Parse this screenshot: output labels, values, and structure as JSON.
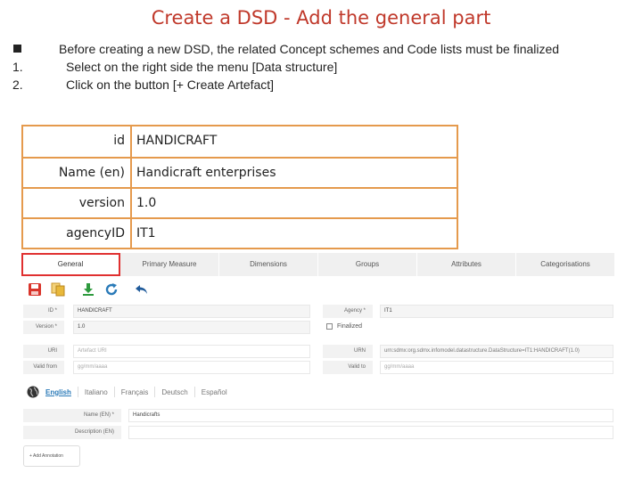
{
  "page": {
    "title": "Create a DSD - Add the general part",
    "steps": [
      {
        "marker": "",
        "text": "Before creating a new DSD, the related Concept schemes and Code lists must be finalized"
      },
      {
        "marker": "1.",
        "text": "Select on the right side the menu [Data structure]"
      },
      {
        "marker": "2.",
        "text": "Click on the button [+ Create Artefact]"
      }
    ]
  },
  "properties": [
    {
      "key": "id",
      "value": "HANDICRAFT"
    },
    {
      "key": "Name (en)",
      "value": "Handicraft enterprises"
    },
    {
      "key": "version",
      "value": "1.0"
    },
    {
      "key": "agencyID",
      "value": "IT1"
    }
  ],
  "app": {
    "tabs": [
      "General",
      "Primary Measure",
      "Dimensions",
      "Groups",
      "Attributes",
      "Categorisations"
    ],
    "active_tab": "General",
    "toolbar": {
      "icons": [
        "save-icon",
        "copy-icon",
        "download-icon",
        "refresh-icon",
        "undo-icon"
      ],
      "colors": {
        "save": "#d9342b",
        "copy": "#e8b83a",
        "download": "#2e9a3e",
        "refresh": "#2a7ab8",
        "undo": "#1f5a9a"
      }
    },
    "form": {
      "id_label": "ID *",
      "id_value": "HANDICRAFT",
      "version_label": "Version *",
      "version_value": "1.0",
      "uri_label": "URI",
      "uri_placeholder": "Artefact URI",
      "valid_from_label": "Valid from",
      "valid_from_placeholder": "gg/mm/aaaa",
      "agency_label": "Agency *",
      "agency_value": "IT1",
      "finalized_label": "Finalized",
      "urn_label": "URN",
      "urn_value": "urn:sdmx:org.sdmx.infomodel.datastructure.DataStructure=IT1:HANDICRAFT(1.0)",
      "valid_to_label": "Valid to",
      "valid_to_placeholder": "gg/mm/aaaa"
    },
    "languages": [
      "English",
      "Italiano",
      "Français",
      "Deutsch",
      "Español"
    ],
    "active_language": "English",
    "name_label": "Name (EN) *",
    "name_value": "Handicrafts",
    "description_label": "Description (EN)",
    "description_value": "",
    "add_annotation_label": "+ Add Annotation"
  }
}
